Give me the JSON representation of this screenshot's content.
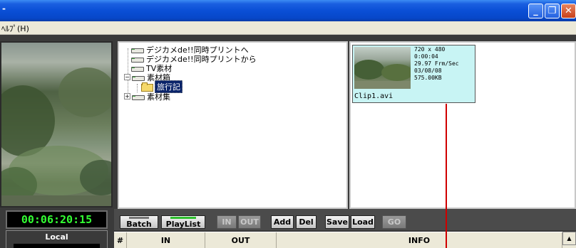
{
  "window": {
    "title": "-"
  },
  "menu": {
    "help_label": "ﾍﾙﾌﾟ(H)"
  },
  "player": {
    "timecode": "00:06:20:15",
    "local_label": "Local"
  },
  "tree": {
    "items": [
      {
        "label": "デジカメde!!同時プリントへ"
      },
      {
        "label": "デジカメde!!同時プリントから"
      },
      {
        "label": "TV素材"
      },
      {
        "label": "素材箱"
      },
      {
        "label": "旅行記"
      },
      {
        "label": "素材集"
      }
    ]
  },
  "clip": {
    "resolution": "720 x 480",
    "duration": "0:00:04",
    "fps": "29.97 Frm/Sec",
    "date": "03/08/08",
    "size": "575.00KB",
    "name": "Clip1.avi"
  },
  "toolbar": {
    "batch": "Batch",
    "playlist": "PlayList",
    "in": "IN",
    "out": "OUT",
    "add": "Add",
    "del": "Del",
    "save": "Save",
    "load": "Load",
    "go": "GO"
  },
  "table": {
    "headers": [
      "#",
      "IN",
      "OUT",
      "INFO"
    ]
  },
  "colors": {
    "timecode": "#33ff33",
    "selection": "#0a246a",
    "marker": "#d00000"
  }
}
